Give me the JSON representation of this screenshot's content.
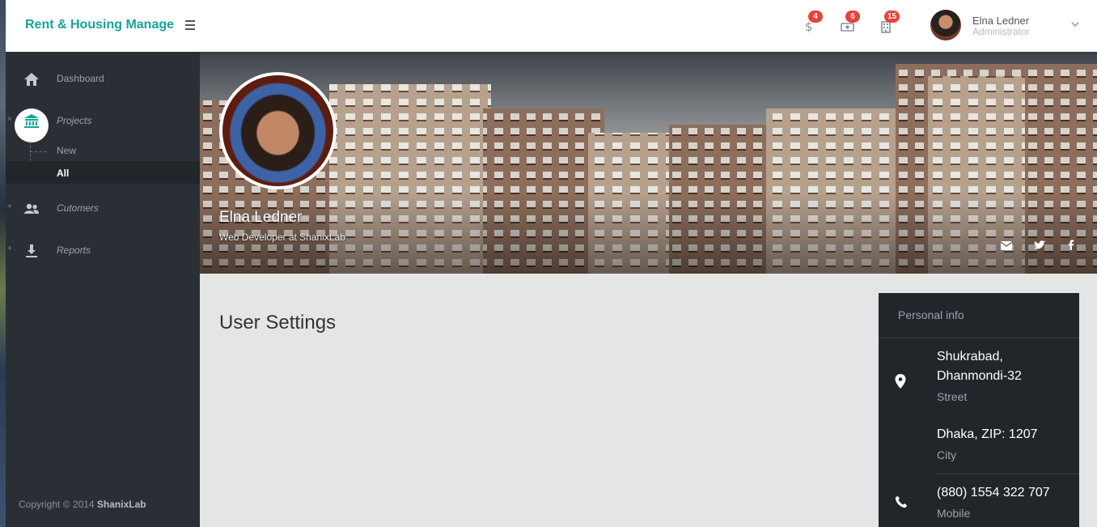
{
  "brand": "Rent & Housing Manage",
  "topbar": {
    "notifications": [
      {
        "icon": "dollar-icon",
        "count": "4"
      },
      {
        "icon": "money-icon",
        "count": "6"
      },
      {
        "icon": "building-icon",
        "count": "15"
      }
    ],
    "user": {
      "name": "Elna Ledner",
      "role": "Administrator"
    }
  },
  "sidebar": {
    "items": [
      {
        "label": "Dashboard",
        "icon": "home-icon"
      },
      {
        "label": "Projects",
        "icon": "bank-icon",
        "toggle": "×"
      },
      {
        "label": "Cutomers",
        "icon": "users-icon",
        "toggle": "+"
      },
      {
        "label": "Reports",
        "icon": "download-icon",
        "toggle": "+"
      }
    ],
    "sub_items": [
      {
        "label": "New"
      },
      {
        "label": "All"
      }
    ],
    "copyright_prefix": "Copyright © 2014",
    "copyright_brand": "ShanixLab"
  },
  "profile": {
    "name": "Elna Ledner",
    "title": "Web Developer at ShanixLab",
    "social": [
      "envelope-icon",
      "twitter-icon",
      "facebook-icon"
    ]
  },
  "main": {
    "title": "User Settings"
  },
  "personal_info": {
    "header": "Personal info",
    "address_line1": "Shukrabad,",
    "address_line2": "Dhanmondi-32",
    "address_label": "Street",
    "city": "Dhaka, ZIP: 1207",
    "city_label": "City",
    "phone": "(880) 1554 322 707",
    "phone_label": "Mobile"
  },
  "colors": {
    "brand": "#19a39a",
    "badge": "#e8423a",
    "sidebar": "#2a2f35",
    "card": "#22262b"
  }
}
